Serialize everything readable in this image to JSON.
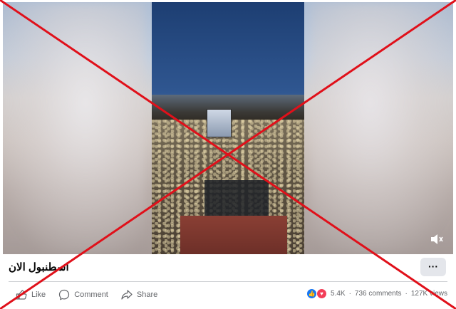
{
  "post": {
    "caption": "اسطنبول الان",
    "more_label": "···"
  },
  "actions": {
    "like_label": "Like",
    "comment_label": "Comment",
    "share_label": "Share"
  },
  "stats": {
    "reactions": "5.4K",
    "comments": "736 comments",
    "views": "127K views",
    "separator": "·"
  },
  "colors": {
    "overlay_x": "#e0101a",
    "like_blue": "#1877f2",
    "love_red": "#f33e58",
    "muted_text": "#65676b"
  },
  "icons": {
    "volume": "speaker-muted-icon",
    "like": "thumbs-up-icon",
    "comment": "comment-bubble-icon",
    "share": "share-arrow-icon"
  }
}
